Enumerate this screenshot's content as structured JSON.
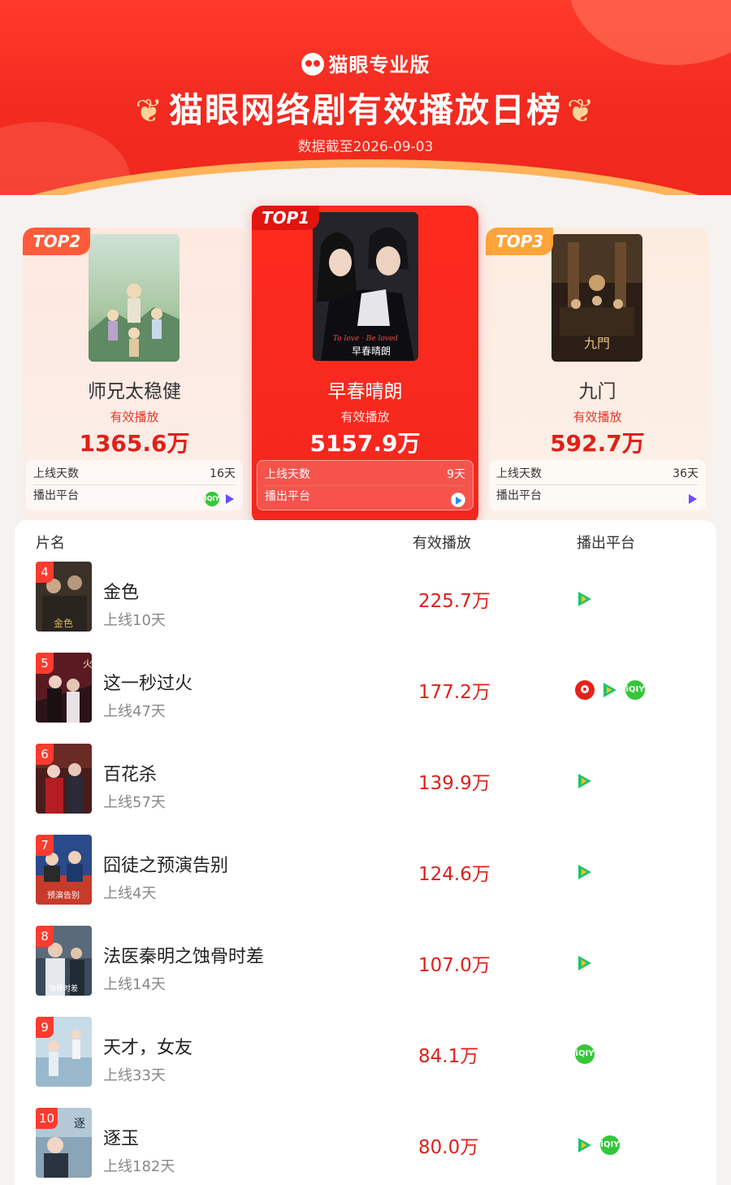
{
  "header": {
    "brand": "猫眼专业版",
    "title": "猫眼网络剧有效播放日榜",
    "subtitle": "数据截至2026-09-03",
    "accent_color": "#f22a20"
  },
  "top_cards": [
    {
      "rank_tag": "TOP1",
      "title": "早春晴朗",
      "play_label": "有效播放",
      "play_value": "5157.9万",
      "days_label": "上线天数",
      "days_value": "9天",
      "platform_label": "播出平台",
      "platforms": [
        "youku"
      ]
    },
    {
      "rank_tag": "TOP2",
      "title": "师兄太稳健",
      "play_label": "有效播放",
      "play_value": "1365.6万",
      "days_label": "上线天数",
      "days_value": "16天",
      "platform_label": "播出平台",
      "platforms": [
        "iqiyi",
        "mango"
      ]
    },
    {
      "rank_tag": "TOP3",
      "title": "九门",
      "play_label": "有效播放",
      "play_value": "592.7万",
      "days_label": "上线天数",
      "days_value": "36天",
      "platform_label": "播出平台",
      "platforms": [
        "mango"
      ]
    }
  ],
  "table": {
    "headers": {
      "name": "片名",
      "play": "有效播放",
      "platform": "播出平台"
    },
    "rows": [
      {
        "rank": "4",
        "title": "金色",
        "days": "上线10天",
        "value": "225.7万",
        "platforms": [
          "tencent"
        ]
      },
      {
        "rank": "5",
        "title": "这一秒过火",
        "days": "上线47天",
        "value": "177.2万",
        "platforms": [
          "youku",
          "tencent",
          "iqiyi"
        ]
      },
      {
        "rank": "6",
        "title": "百花杀",
        "days": "上线57天",
        "value": "139.9万",
        "platforms": [
          "tencent"
        ]
      },
      {
        "rank": "7",
        "title": "囧徒之预演告别",
        "days": "上线4天",
        "value": "124.6万",
        "platforms": [
          "tencent"
        ]
      },
      {
        "rank": "8",
        "title": "法医秦明之蚀骨时差",
        "days": "上线14天",
        "value": "107.0万",
        "platforms": [
          "tencent"
        ]
      },
      {
        "rank": "9",
        "title": "天才，女友",
        "days": "上线33天",
        "value": "84.1万",
        "platforms": [
          "iqiyi"
        ]
      },
      {
        "rank": "10",
        "title": "逐玉",
        "days": "上线182天",
        "value": "80.0万",
        "platforms": [
          "tencent",
          "iqiyi"
        ]
      }
    ]
  }
}
